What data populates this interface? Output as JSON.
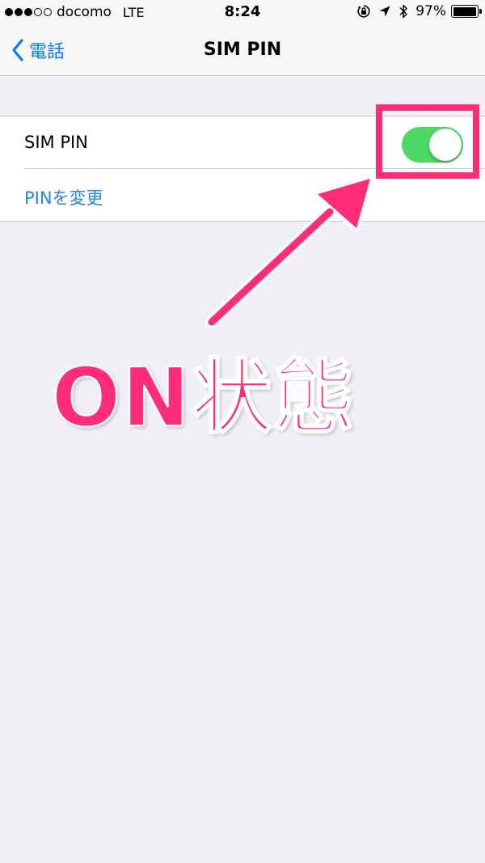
{
  "status_bar": {
    "carrier": "docomo",
    "network": "LTE",
    "time": "8:24",
    "battery": "97%",
    "battery_level": 0.97,
    "signal_full": 3,
    "signal_empty": 2,
    "icons": [
      "orientation-lock-icon",
      "location-arrow-icon",
      "bluetooth-icon",
      "battery-icon"
    ]
  },
  "nav": {
    "back_label": "電話",
    "title": "SIM PIN"
  },
  "settings": {
    "sim_pin_label": "SIM PIN",
    "sim_pin_enabled": true,
    "change_pin_label": "PINを変更"
  },
  "annotation": {
    "text": "ON状態",
    "color": "#ff2d78"
  },
  "colors": {
    "accent": "#007aff",
    "toggle_on": "#4cd964",
    "background": "#efeff4"
  }
}
